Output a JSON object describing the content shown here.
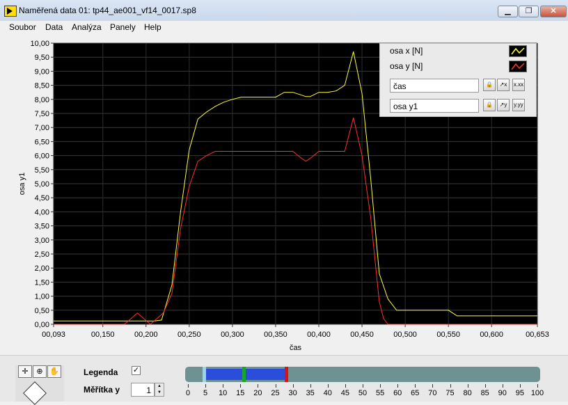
{
  "window": {
    "title": "Naměřená data 01: tp44_ae001_vf14_0017.sp8",
    "controls": [
      "minimize",
      "restore",
      "close"
    ]
  },
  "menu": [
    "Soubor",
    "Data",
    "Analýza",
    "Panely",
    "Help"
  ],
  "legend": {
    "plots": [
      {
        "name": "osa x [N]",
        "color": "#ffff40"
      },
      {
        "name": "osa y [N]",
        "color": "#ff3030"
      }
    ],
    "scales": [
      {
        "name": "čas",
        "format_button": "x.xx"
      },
      {
        "name": "osa y1",
        "format_button": "y.yy"
      }
    ]
  },
  "options": {
    "legend_label": "Legenda",
    "legend_checked": true,
    "scale_label": "Měřítka y",
    "scale_value": "1"
  },
  "slider": {
    "ticks": [
      "0",
      "5",
      "10",
      "15",
      "20",
      "25",
      "30",
      "35",
      "40",
      "45",
      "50",
      "55",
      "60",
      "65",
      "70",
      "75",
      "80",
      "85",
      "90",
      "95",
      "100"
    ],
    "min": 0,
    "max": 100,
    "handles": [
      {
        "value": 4.5,
        "color": "#9dd3e8"
      },
      {
        "value": 16,
        "color": "#17a52e"
      },
      {
        "value": 28,
        "color": "#e01010"
      }
    ]
  },
  "chart_data": {
    "type": "line",
    "xlabel": "čas",
    "ylabel": "osa y1",
    "xlim": [
      0.093,
      0.653
    ],
    "ylim": [
      0,
      10
    ],
    "x_ticks": [
      "00,093",
      "00,150",
      "00,200",
      "00,250",
      "00,300",
      "00,350",
      "00,400",
      "00,450",
      "00,500",
      "00,550",
      "00,600",
      "00,653"
    ],
    "x_tick_values": [
      0.093,
      0.15,
      0.2,
      0.25,
      0.3,
      0.35,
      0.4,
      0.45,
      0.5,
      0.55,
      0.6,
      0.653
    ],
    "y_ticks": [
      "0,00",
      "0,50",
      "1,00",
      "1,50",
      "2,00",
      "2,50",
      "3,00",
      "3,50",
      "4,00",
      "4,50",
      "5,00",
      "5,50",
      "6,00",
      "6,50",
      "7,00",
      "7,50",
      "8,00",
      "8,50",
      "9,00",
      "9,50",
      "10,00"
    ],
    "background": "#000000",
    "grid": true,
    "series": [
      {
        "name": "osa x [N]",
        "color": "#ffff40",
        "x": [
          0.093,
          0.21,
          0.218,
          0.23,
          0.24,
          0.25,
          0.26,
          0.27,
          0.28,
          0.29,
          0.3,
          0.31,
          0.32,
          0.33,
          0.34,
          0.35,
          0.36,
          0.37,
          0.38,
          0.385,
          0.39,
          0.4,
          0.41,
          0.42,
          0.43,
          0.44,
          0.45,
          0.46,
          0.47,
          0.48,
          0.49,
          0.55,
          0.56,
          0.653
        ],
        "y": [
          0.12,
          0.12,
          0.15,
          1.4,
          4.0,
          6.2,
          7.3,
          7.55,
          7.75,
          7.9,
          8.0,
          8.08,
          8.08,
          8.08,
          8.08,
          8.08,
          8.25,
          8.25,
          8.15,
          8.1,
          8.1,
          8.25,
          8.25,
          8.3,
          8.5,
          9.7,
          8.2,
          5.2,
          1.8,
          0.9,
          0.5,
          0.5,
          0.3,
          0.3
        ]
      },
      {
        "name": "osa y [N]",
        "color": "#ff3030",
        "x": [
          0.093,
          0.175,
          0.19,
          0.205,
          0.22,
          0.23,
          0.24,
          0.25,
          0.26,
          0.27,
          0.28,
          0.29,
          0.3,
          0.31,
          0.32,
          0.33,
          0.34,
          0.35,
          0.36,
          0.37,
          0.38,
          0.385,
          0.39,
          0.4,
          0.41,
          0.42,
          0.43,
          0.44,
          0.45,
          0.46,
          0.47,
          0.475,
          0.48,
          0.653
        ],
        "y": [
          0.0,
          0.0,
          0.4,
          0.0,
          0.4,
          1.1,
          3.4,
          4.9,
          5.8,
          6.0,
          6.15,
          6.15,
          6.15,
          6.15,
          6.15,
          6.15,
          6.15,
          6.15,
          6.15,
          6.15,
          5.9,
          5.8,
          5.9,
          6.15,
          6.15,
          6.15,
          6.15,
          7.35,
          6.0,
          3.8,
          0.8,
          0.2,
          0.0,
          0.0
        ]
      }
    ]
  }
}
